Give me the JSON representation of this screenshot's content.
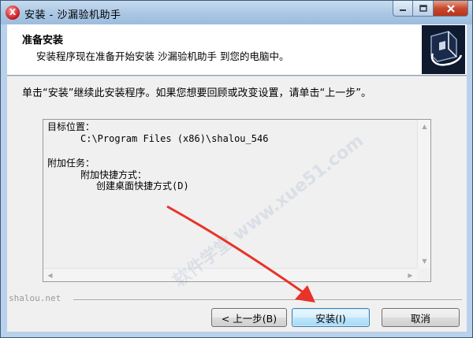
{
  "window": {
    "title": "安装 - 沙漏验机助手",
    "icon_letter": "X"
  },
  "header": {
    "title": "准备安装",
    "subtitle": "安装程序现在准备开始安装 沙漏验机助手 到您的电脑中。"
  },
  "body": {
    "intro": "单击“安装”继续此安装程序。如果您想要回顾或改变设置，请单击“上一步”。",
    "memo": {
      "dest_label": "目标位置：",
      "dest_value": "C:\\Program Files (x86)\\shalou_546",
      "tasks_label": "附加任务：",
      "tasks_group": "附加快捷方式：",
      "tasks_item": "创建桌面快捷方式(D)"
    }
  },
  "footer": {
    "brand": "shalou.net",
    "back_label": "< 上一步(B)",
    "install_label": "安装(I)",
    "cancel_label": "取消"
  },
  "watermark": {
    "text": "软件学堂 www.xue51.com"
  },
  "colors": {
    "annotation_arrow": "#e8332a",
    "titlebar": "#a9c6e4",
    "close_button": "#c84a2e"
  }
}
